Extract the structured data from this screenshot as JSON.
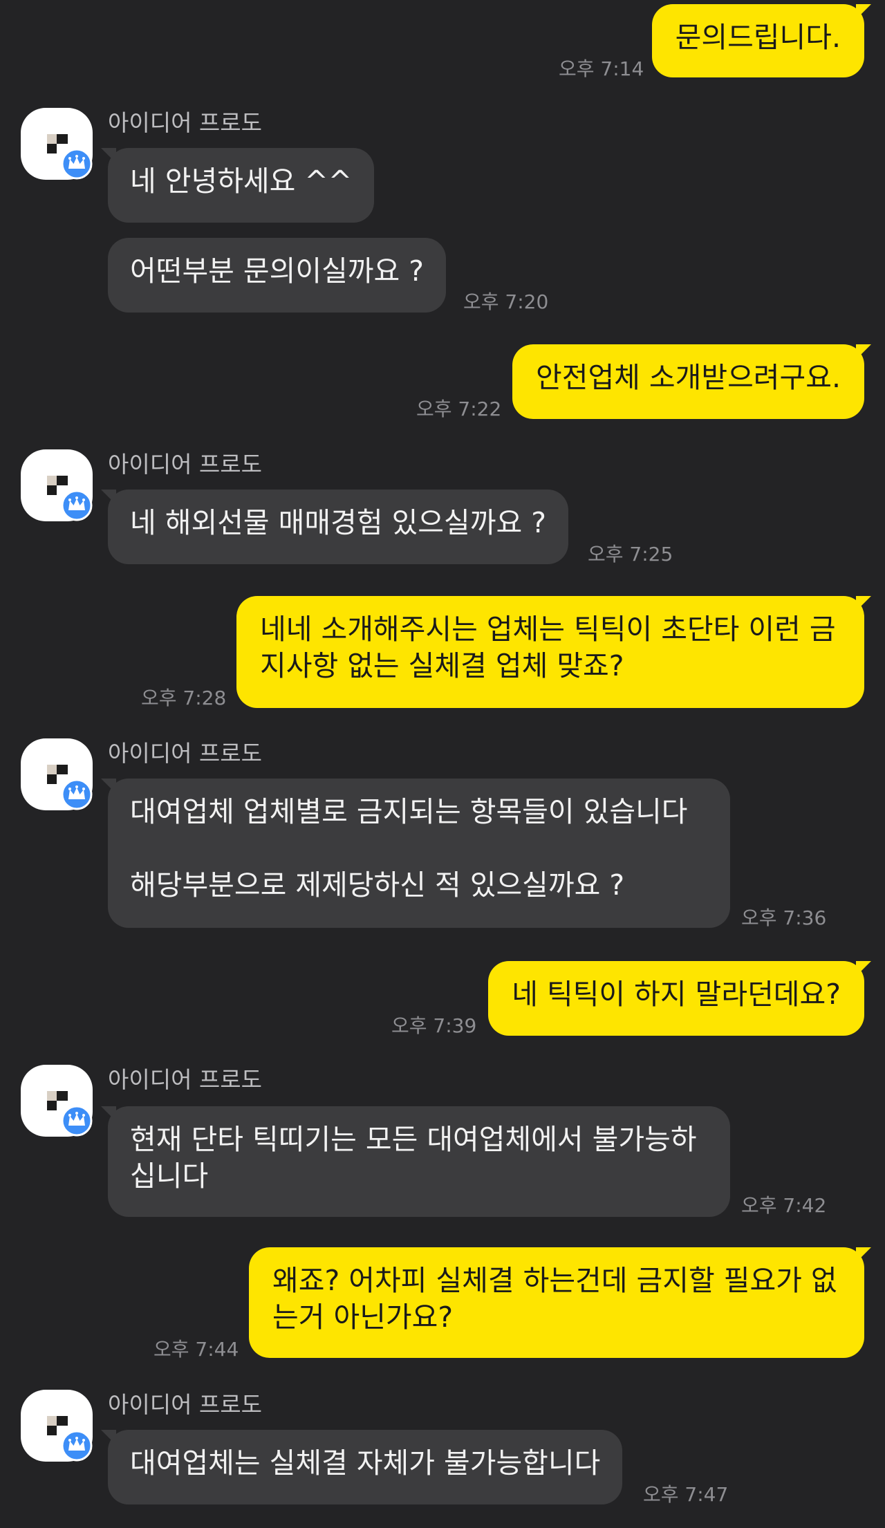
{
  "chat": {
    "partner_name": "아이디어 프로도",
    "messages": [
      {
        "from": "me",
        "text": "문의드립니다.",
        "time": "오후 7:14"
      },
      {
        "from": "them",
        "text": "네 안녕하세요 ^^",
        "time": ""
      },
      {
        "from": "them",
        "text": "어떤부분 문의이실까요 ?",
        "time": "오후 7:20"
      },
      {
        "from": "me",
        "text": "안전업체 소개받으려구요.",
        "time": "오후 7:22"
      },
      {
        "from": "them",
        "text": "네 해외선물 매매경험 있으실까요 ?",
        "time": "오후 7:25"
      },
      {
        "from": "me",
        "line1": "네네 소개해주시는 업체는 틱틱이 초단타 이런 금",
        "line2": "지사항 없는 실체결 업체 맞죠?",
        "time": "오후 7:28"
      },
      {
        "from": "them",
        "line1": "대여업체 업체별로 금지되는 항목들이 있습니다",
        "line2": "해당부분으로 제제당하신 적 있으실까요 ?",
        "time": "오후 7:36"
      },
      {
        "from": "me",
        "text": "네 틱틱이 하지 말라던데요?",
        "time": "오후 7:39"
      },
      {
        "from": "them",
        "line1": "현재 단타 틱띠기는 모든 대여업체에서 불가능하",
        "line2": "십니다",
        "time": "오후 7:42"
      },
      {
        "from": "me",
        "line1": "왜죠? 어차피 실체결 하는건데 금지할 필요가 없",
        "line2": "는거 아닌가요?",
        "time": "오후 7:44"
      },
      {
        "from": "them",
        "text": "대여업체는 실체결 자체가 불가능합니다",
        "time": "오후 7:47"
      }
    ]
  },
  "colors": {
    "background": "#232325",
    "my_bubble": "#fee500",
    "their_bubble": "#3c3c3e",
    "badge": "#3d8ef7"
  },
  "icons": {
    "avatar": "profile-avatar",
    "badge": "crown-icon"
  }
}
